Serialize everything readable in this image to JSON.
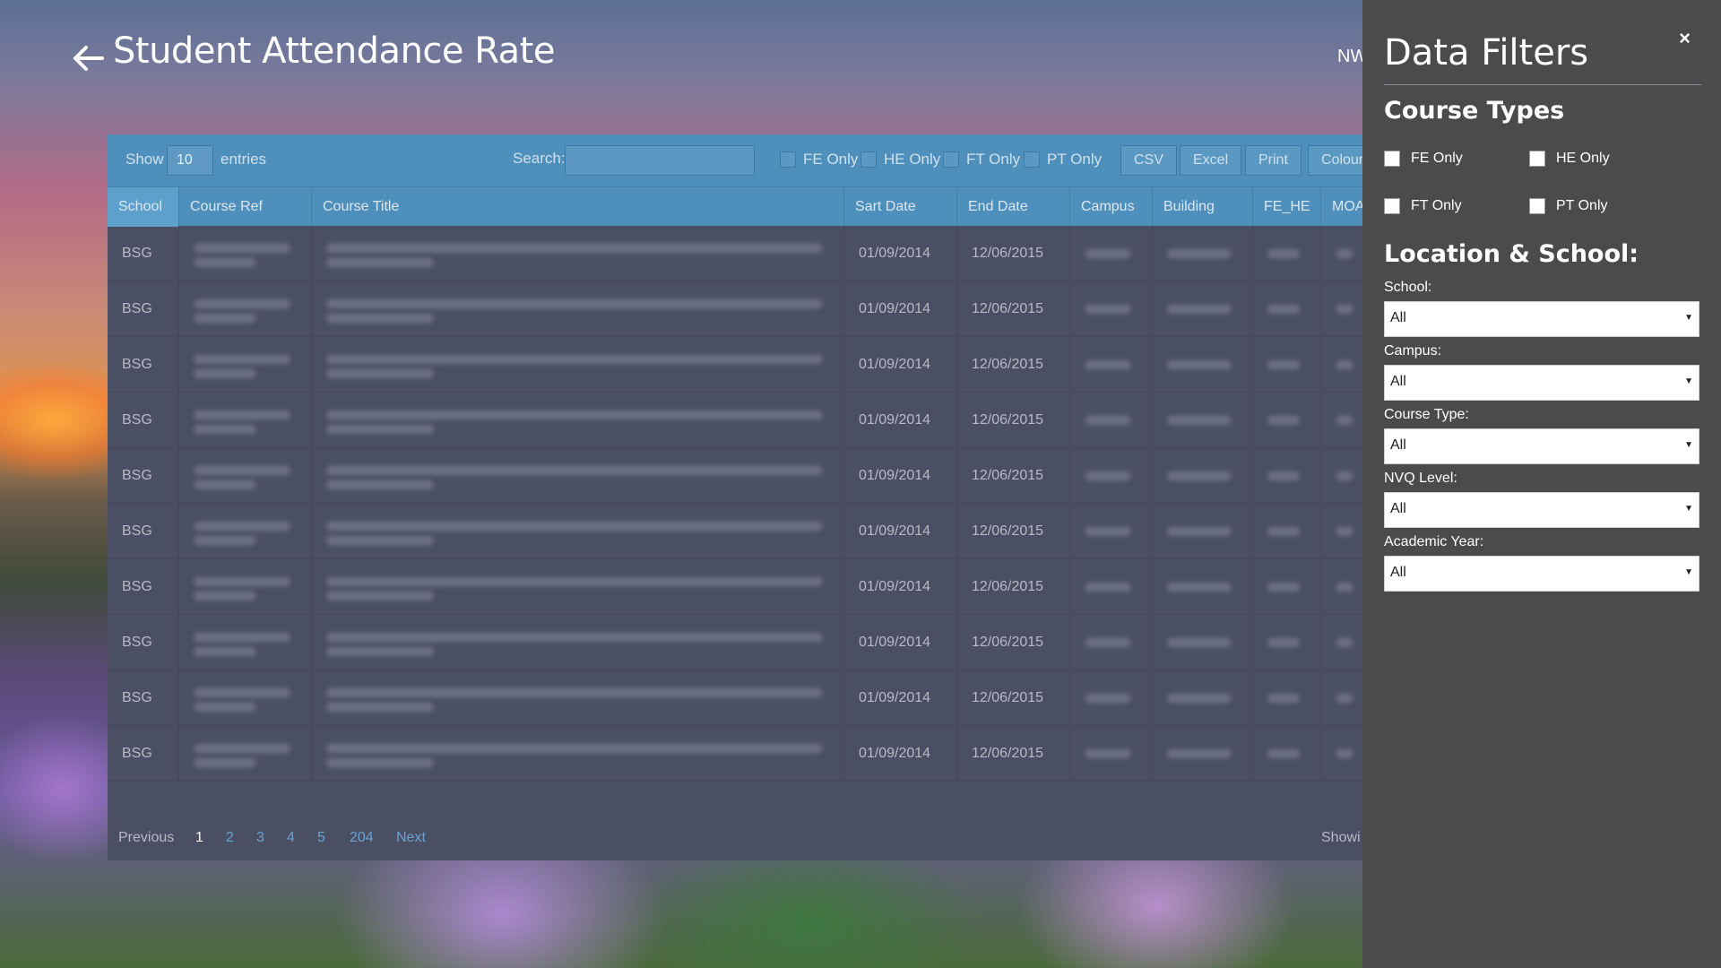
{
  "header": {
    "title": "Student Attendance Rate",
    "right_text": "NW"
  },
  "toolbar": {
    "show_label": "Show",
    "show_value": "10",
    "entries_label": "entries",
    "search_label": "Search:",
    "search_value": "",
    "checks": [
      "FE Only",
      "HE Only",
      "FT Only",
      "PT Only"
    ],
    "buttons": [
      "CSV",
      "Excel",
      "Print",
      "Colour"
    ]
  },
  "table": {
    "columns": [
      "School",
      "Course Ref",
      "Course Title",
      "Sart Date",
      "End Date",
      "Campus",
      "Building",
      "FE_HE",
      "MOA"
    ],
    "rows": [
      {
        "school": "BSG",
        "start": "01/09/2014",
        "end": "12/06/2015"
      },
      {
        "school": "BSG",
        "start": "01/09/2014",
        "end": "12/06/2015"
      },
      {
        "school": "BSG",
        "start": "01/09/2014",
        "end": "12/06/2015"
      },
      {
        "school": "BSG",
        "start": "01/09/2014",
        "end": "12/06/2015"
      },
      {
        "school": "BSG",
        "start": "01/09/2014",
        "end": "12/06/2015"
      },
      {
        "school": "BSG",
        "start": "01/09/2014",
        "end": "12/06/2015"
      },
      {
        "school": "BSG",
        "start": "01/09/2014",
        "end": "12/06/2015"
      },
      {
        "school": "BSG",
        "start": "01/09/2014",
        "end": "12/06/2015"
      },
      {
        "school": "BSG",
        "start": "01/09/2014",
        "end": "12/06/2015"
      },
      {
        "school": "BSG",
        "start": "01/09/2014",
        "end": "12/06/2015"
      }
    ]
  },
  "pagination": {
    "previous": "Previous",
    "current": "1",
    "pages": [
      "2",
      "3",
      "4",
      "5",
      "204"
    ],
    "next": "Next",
    "showing": "Showi"
  },
  "sidebar": {
    "title": "Data Filters",
    "close": "×",
    "course_types_heading": "Course Types",
    "course_types": [
      "FE Only",
      "HE Only",
      "FT Only",
      "PT Only"
    ],
    "location_heading": "Location & School:",
    "filters": [
      {
        "label": "School:",
        "value": "All"
      },
      {
        "label": "Campus:",
        "value": "All"
      },
      {
        "label": "Course Type:",
        "value": "All"
      },
      {
        "label": "NVQ Level:",
        "value": "All"
      },
      {
        "label": "Academic Year:",
        "value": "All"
      }
    ]
  },
  "icons": {
    "back": "arrow-left-icon",
    "close": "close-icon",
    "dropdown": "caret-down-icon"
  }
}
